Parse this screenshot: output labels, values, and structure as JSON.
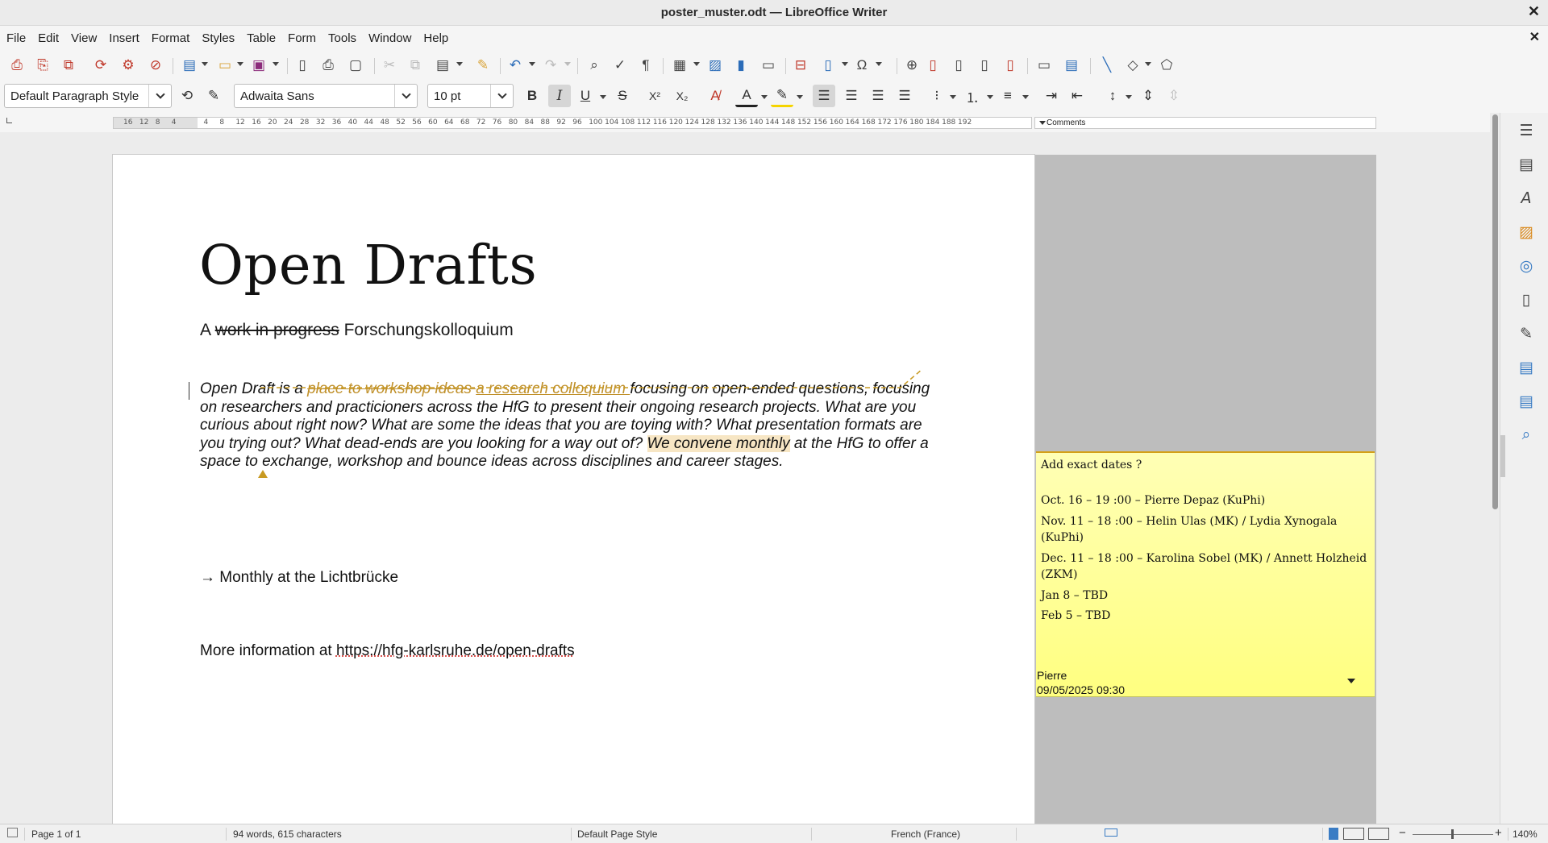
{
  "window": {
    "title": "poster_muster.odt — LibreOffice Writer",
    "close_glyph": "✕",
    "doc_close_glyph": "✕"
  },
  "menu": {
    "items": [
      "File",
      "Edit",
      "View",
      "Insert",
      "Format",
      "Styles",
      "Table",
      "Form",
      "Tools",
      "Window",
      "Help"
    ]
  },
  "toolbar2": {
    "paragraph_style": "Default Paragraph Style",
    "font_name": "Adwaita Sans",
    "font_size": "10 pt",
    "bold": "B",
    "italic": "I",
    "underline": "U",
    "strike": "S",
    "superscript": "X²",
    "subscript": "X₂"
  },
  "ruler": {
    "ticks": [
      "16",
      "12",
      "8",
      "4",
      "",
      "4",
      "8",
      "12",
      "16",
      "20",
      "24",
      "28",
      "32",
      "36",
      "40",
      "44",
      "48",
      "52",
      "56",
      "60",
      "64",
      "68",
      "72",
      "76",
      "80",
      "84",
      "88",
      "92",
      "96",
      "100",
      "104",
      "108",
      "112",
      "116",
      "120",
      "124",
      "128",
      "132",
      "136",
      "140",
      "144",
      "148",
      "152",
      "156",
      "160",
      "164",
      "168",
      "172",
      "176",
      "180",
      "184",
      "188",
      "192"
    ],
    "comments_label": "Comments"
  },
  "document": {
    "title": "Open Drafts",
    "subtitle_prefix": "A ",
    "subtitle_deleted": "work  in  progress",
    "subtitle_suffix": " Forschungskolloquium",
    "para_1": "Open Draft is a ",
    "para_deleted": "place to workshop ideas ",
    "para_inserted": " a research colloquium ",
    "para_2": "focusing on open-ended questions, focusing on researchers and practicioners across the HfG to present their ongoing research projects. What are you curious about right now? What are some the ideas that you are toying with?  What presentation formats are you trying out? What dead-ends are you looking for a way out of? ",
    "para_highlight": "We convene monthly",
    "para_3": " at the HfG to offer a space to exchange, workshop and bounce ideas across disciplines and career stages.",
    "monthly_line": "→ Monthly at the Lichtbrücke",
    "more_prefix": "More information at ",
    "more_url": "https://hfg-karlsruhe.de/open-drafts"
  },
  "comment": {
    "heading": "Add exact dates ?",
    "lines": [
      "Oct. 16 – 19 :00 – Pierre Depaz (KuPhi)",
      "Nov. 11 – 18 :00 – Helin Ulas (MK) / Lydia Xynogala",
      "(KuPhi)",
      "Dec. 11 – 18 :00 – Karolina Sobel (MK) / Annett Holzheid",
      "(ZKM)",
      "Jan 8 – TBD",
      "Feb 5 – TBD"
    ],
    "author": "Pierre",
    "date": "09/05/2025 09:30"
  },
  "statusbar": {
    "page": "Page 1 of 1",
    "words": "94 words, 615 characters",
    "page_style": "Default Page Style",
    "language": "French (France)",
    "zoom_minus": "−",
    "zoom_plus": "+",
    "zoom": "140%"
  },
  "colors": {
    "track_change": "#c0902a",
    "comment_bg": "#ffff9e",
    "highlight": "#f7e6c4"
  },
  "icons": {
    "sidebar": [
      "hamburger-icon",
      "properties-icon",
      "styles-icon",
      "gallery-icon",
      "navigator-icon",
      "page-icon",
      "style-inspector-icon",
      "manage-changes-icon",
      "design-icon",
      "find-icon"
    ]
  }
}
